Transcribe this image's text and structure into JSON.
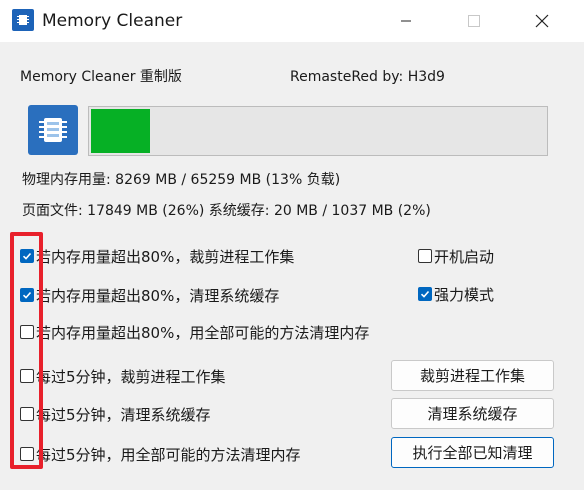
{
  "window": {
    "title": "Memory Cleaner"
  },
  "header": {
    "left": "Memory Cleaner 重制版",
    "right": "RemasteRed by: H3d9"
  },
  "memory": {
    "usage_fraction": 0.13,
    "bar_color": "#06b025",
    "physical": "物理内存用量: 8269 MB / 65259 MB (13% 负载)",
    "page_and_cache": "页面文件: 17849 MB (26%)   系统缓存: 20 MB / 1037 MB (2%)"
  },
  "options": {
    "auto_trim_80": {
      "label": "若内存用量超出80%，裁剪进程工作集",
      "checked": true
    },
    "auto_cache_80": {
      "label": "若内存用量超出80%，清理系统缓存",
      "checked": true
    },
    "auto_all_80": {
      "label": "若内存用量超出80%，用全部可能的方法清理内存",
      "checked": false
    },
    "timer_trim_5": {
      "label": "每过5分钟，裁剪进程工作集",
      "checked": false
    },
    "timer_cache_5": {
      "label": "每过5分钟，清理系统缓存",
      "checked": false
    },
    "timer_all_5": {
      "label": "每过5分钟，用全部可能的方法清理内存",
      "checked": false
    },
    "startup": {
      "label": "开机启动",
      "checked": false
    },
    "strong_mode": {
      "label": "强力模式",
      "checked": true
    }
  },
  "buttons": {
    "trim_working_set": "裁剪进程工作集",
    "clear_system_cache": "清理系统缓存",
    "run_all_cleanup": "执行全部已知清理"
  },
  "colors": {
    "accent": "#0067c0",
    "highlight_frame": "#e8202b"
  }
}
